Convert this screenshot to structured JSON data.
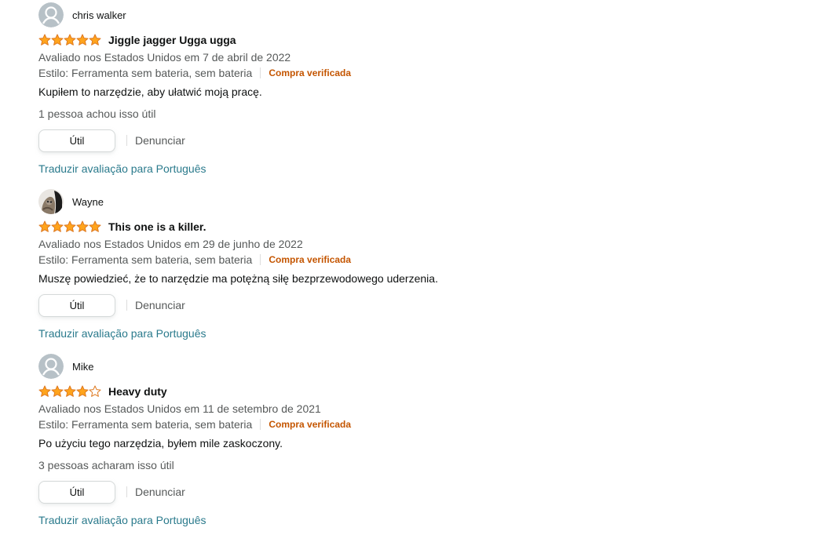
{
  "reviews": [
    {
      "name": "chris walker",
      "avatar": "default-avatar-icon",
      "rating": 5,
      "title": "Jiggle jagger Ugga ugga",
      "date_line": "Avaliado nos Estados Unidos em 7 de abril de 2022",
      "style": "Estilo: Ferramenta sem bateria, sem bateria",
      "verified": "Compra verificada",
      "body": "Kupiłem to narzędzie, aby ułatwić moją pracę.",
      "helpful_count": "1 pessoa achou isso útil",
      "util_label": "Útil",
      "report_label": "Denunciar",
      "translate_label": "Traduzir avaliação para Português"
    },
    {
      "name": "Wayne",
      "avatar": "photo-avatar",
      "rating": 5,
      "title": "This one is a killer.",
      "date_line": "Avaliado nos Estados Unidos em 29 de junho de 2022",
      "style": "Estilo: Ferramenta sem bateria, sem bateria",
      "verified": "Compra verificada",
      "body": "Muszę powiedzieć, że to narzędzie ma potężną siłę bezprzewodowego uderzenia.",
      "util_label": "Útil",
      "report_label": "Denunciar",
      "translate_label": "Traduzir avaliação para Português"
    },
    {
      "name": "Mike",
      "avatar": "default-avatar-icon",
      "rating": 4,
      "title": "Heavy duty",
      "date_line": "Avaliado nos Estados Unidos em 11 de setembro de 2021",
      "style": "Estilo: Ferramenta sem bateria, sem bateria",
      "verified": "Compra verificada",
      "body": "Po użyciu tego narzędzia, byłem mile zaskoczony.",
      "helpful_count": "3 pessoas acharam isso útil",
      "util_label": "Útil",
      "report_label": "Denunciar",
      "translate_label": "Traduzir avaliação para Português"
    }
  ],
  "colors": {
    "star_fill": "#ffa41c",
    "star_stroke": "#de7921",
    "verified": "#c45500",
    "link": "#2a7a8c"
  }
}
